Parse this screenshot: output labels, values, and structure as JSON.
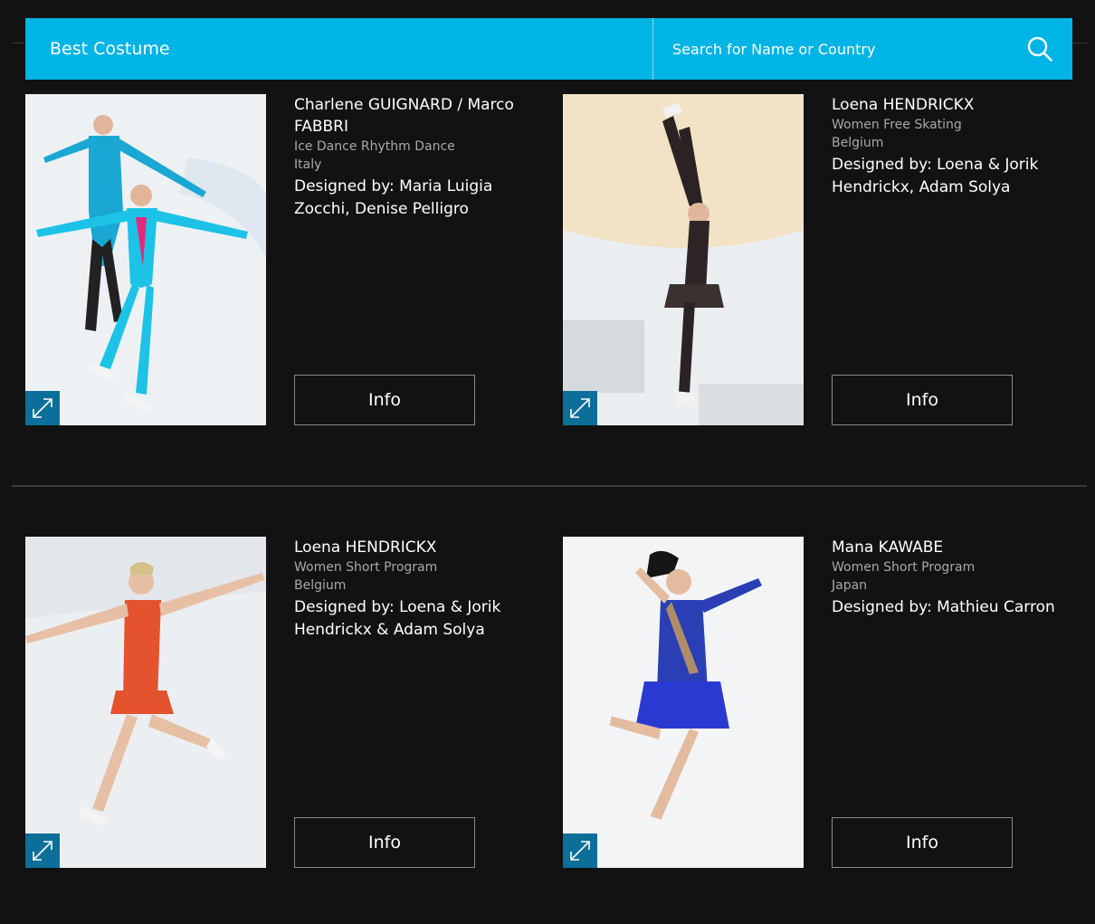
{
  "header": {
    "title": "Best Costume",
    "search_placeholder": "Search for Name or Country"
  },
  "cards": [
    {
      "name": "Charlene GUIGNARD / Marco FABBRI",
      "category": "Ice Dance Rhythm Dance",
      "country": "Italy",
      "designer": "Designed by: Maria Luigia Zocchi, Denise Pelligro",
      "info_label": "Info"
    },
    {
      "name": "Loena HENDRICKX",
      "category": "Women Free Skating",
      "country": "Belgium",
      "designer": "Designed by: Loena & Jorik Hendrickx, Adam Solya",
      "info_label": "Info"
    },
    {
      "name": "Loena HENDRICKX",
      "category": "Women Short Program",
      "country": "Belgium",
      "designer": "Designed by: Loena & Jorik Hendrickx & Adam Solya",
      "info_label": "Info"
    },
    {
      "name": "Mana KAWABE",
      "category": "Women Short Program",
      "country": "Japan",
      "designer": "Designed by: Mathieu Carron",
      "info_label": "Info"
    }
  ],
  "icons": {
    "search": "search-icon",
    "expand": "expand-icon"
  },
  "colors": {
    "accent": "#00b4e6",
    "expand_badge": "#0b6f99",
    "background": "#121212"
  }
}
